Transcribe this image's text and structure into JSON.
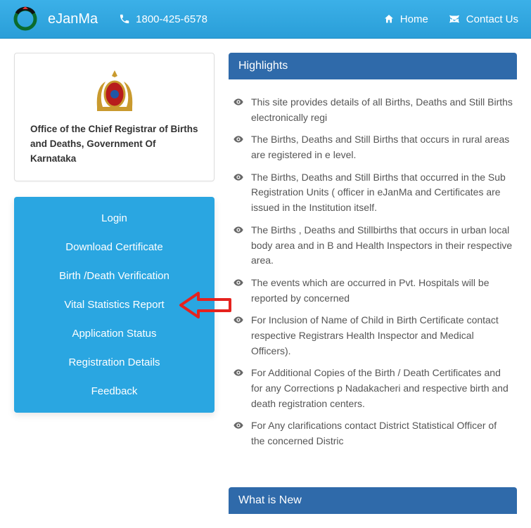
{
  "topbar": {
    "brand": "eJanMa",
    "phone": "1800-425-6578",
    "nav": {
      "home": "Home",
      "contact": "Contact Us"
    }
  },
  "left_card": {
    "office_text": "Office of the Chief Registrar of Births and Deaths, Government Of Karnataka"
  },
  "sidenav": [
    "Login",
    "Download Certificate",
    "Birth /Death Verification",
    "Vital Statistics Report",
    "Application Status",
    "Registration Details",
    "Feedback"
  ],
  "highlights": {
    "title": "Highlights",
    "items": [
      "This site provides details of all Births, Deaths and Still Births electronically regi",
      "The Births, Deaths and Still Births that occurs in rural areas are registered in e level.",
      "The Births, Deaths and Still Births that occurred in the Sub Registration Units ( officer in eJanMa and Certificates are issued in the Institution itself.",
      "The Births , Deaths and Stillbirths that occurs in urban local body area and in B and Health Inspectors in their respective area.",
      "The events which are occurred in Pvt. Hospitals will be reported by concerned",
      "For Inclusion of Name of Child in Birth Certificate contact respective Registrars Health Inspector and Medical Officers).",
      "For Additional Copies of the Birth / Death Certificates and for any Corrections p Nadakacheri and respective birth and death registration centers.",
      "For Any clarifications contact District Statistical Officer of the concerned Distric"
    ]
  },
  "whats_new": {
    "title": "What is New"
  }
}
